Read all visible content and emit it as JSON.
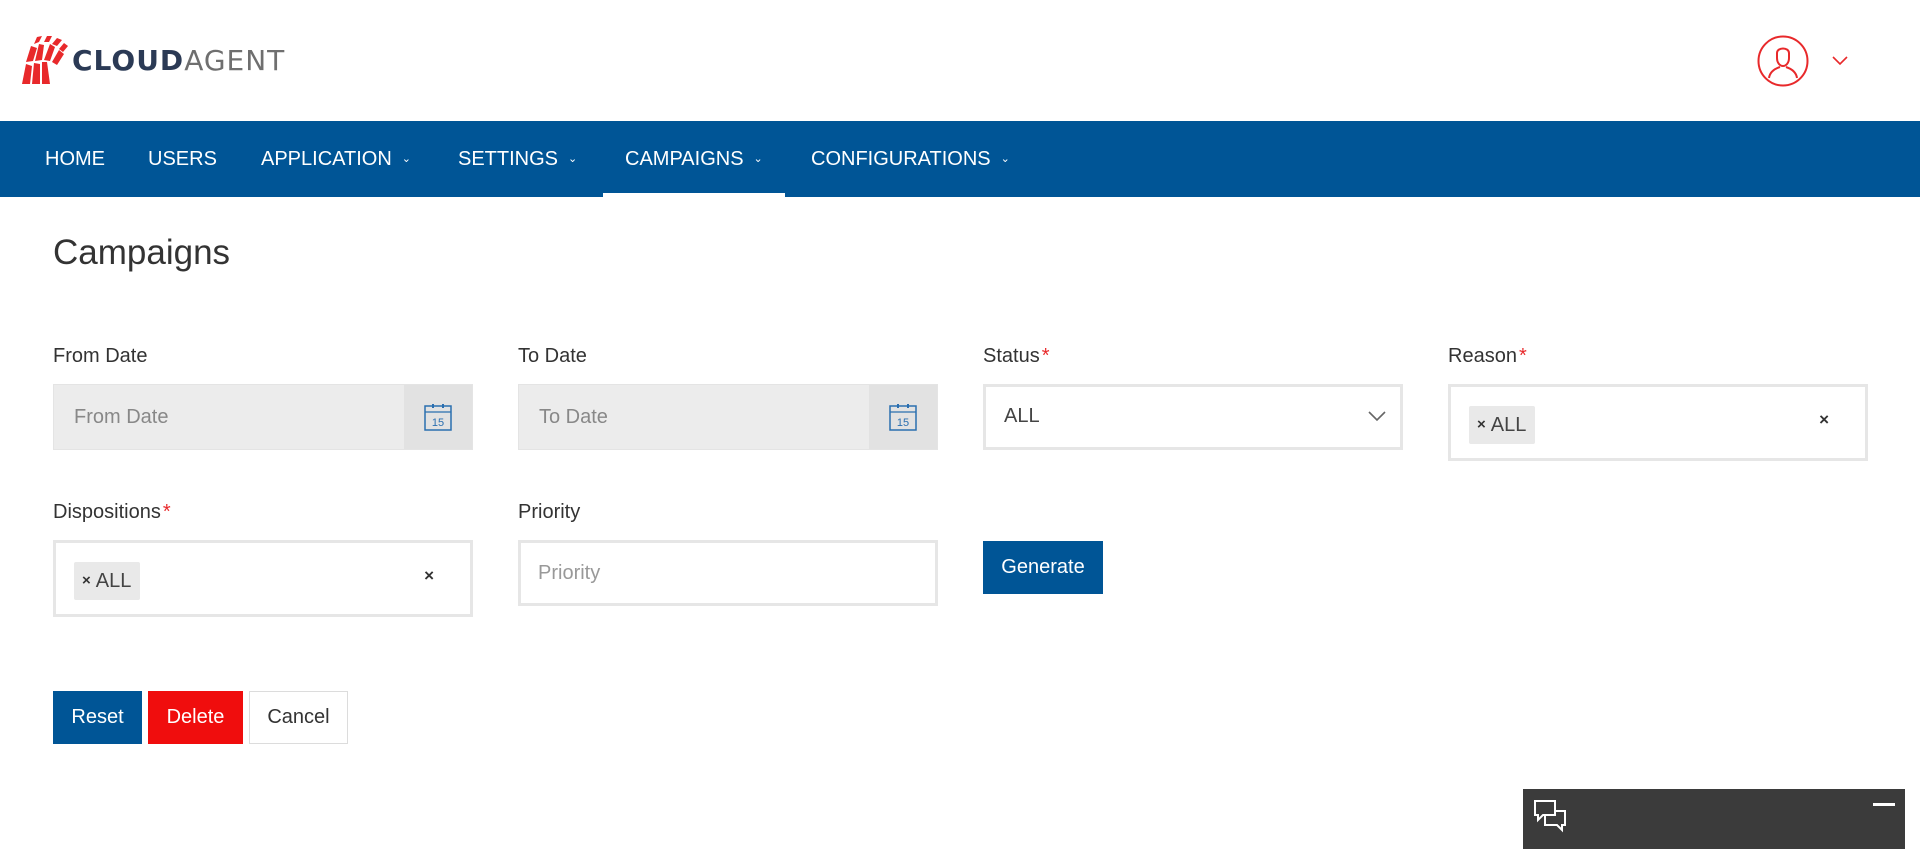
{
  "brand": {
    "name_part1": "CLOUD",
    "name_part2": "AGENT",
    "logo_color": "#e8292b",
    "primary_color": "#005596"
  },
  "header": {
    "avatar_icon": "user-circle-icon",
    "menu_icon": "chevron-down-icon"
  },
  "nav": {
    "items": [
      {
        "label": "HOME",
        "has_dropdown": false
      },
      {
        "label": "USERS",
        "has_dropdown": false
      },
      {
        "label": "APPLICATION",
        "has_dropdown": true
      },
      {
        "label": "SETTINGS",
        "has_dropdown": true
      },
      {
        "label": "CAMPAIGNS",
        "has_dropdown": true,
        "active": true
      },
      {
        "label": "CONFIGURATIONS",
        "has_dropdown": true
      }
    ]
  },
  "page": {
    "title": "Campaigns"
  },
  "form": {
    "from_date": {
      "label": "From Date",
      "placeholder": "From Date",
      "icon": "calendar-icon",
      "icon_text": "15"
    },
    "to_date": {
      "label": "To Date",
      "placeholder": "To Date",
      "icon": "calendar-icon",
      "icon_text": "15"
    },
    "status": {
      "label": "Status",
      "required_mark": "*",
      "value": "ALL"
    },
    "reason": {
      "label": "Reason",
      "required_mark": "*",
      "chips": [
        "ALL"
      ],
      "chip_remove": "×",
      "clear": "×"
    },
    "dispositions": {
      "label": "Dispositions",
      "required_mark": "*",
      "chips": [
        "ALL"
      ],
      "chip_remove": "×",
      "clear": "×"
    },
    "priority": {
      "label": "Priority",
      "placeholder": "Priority",
      "value": ""
    },
    "generate_label": "Generate"
  },
  "actions": {
    "reset_label": "Reset",
    "delete_label": "Delete",
    "cancel_label": "Cancel"
  },
  "chat_widget": {
    "icon": "chat-bubbles-icon",
    "minimize_icon": "minimize-icon"
  }
}
